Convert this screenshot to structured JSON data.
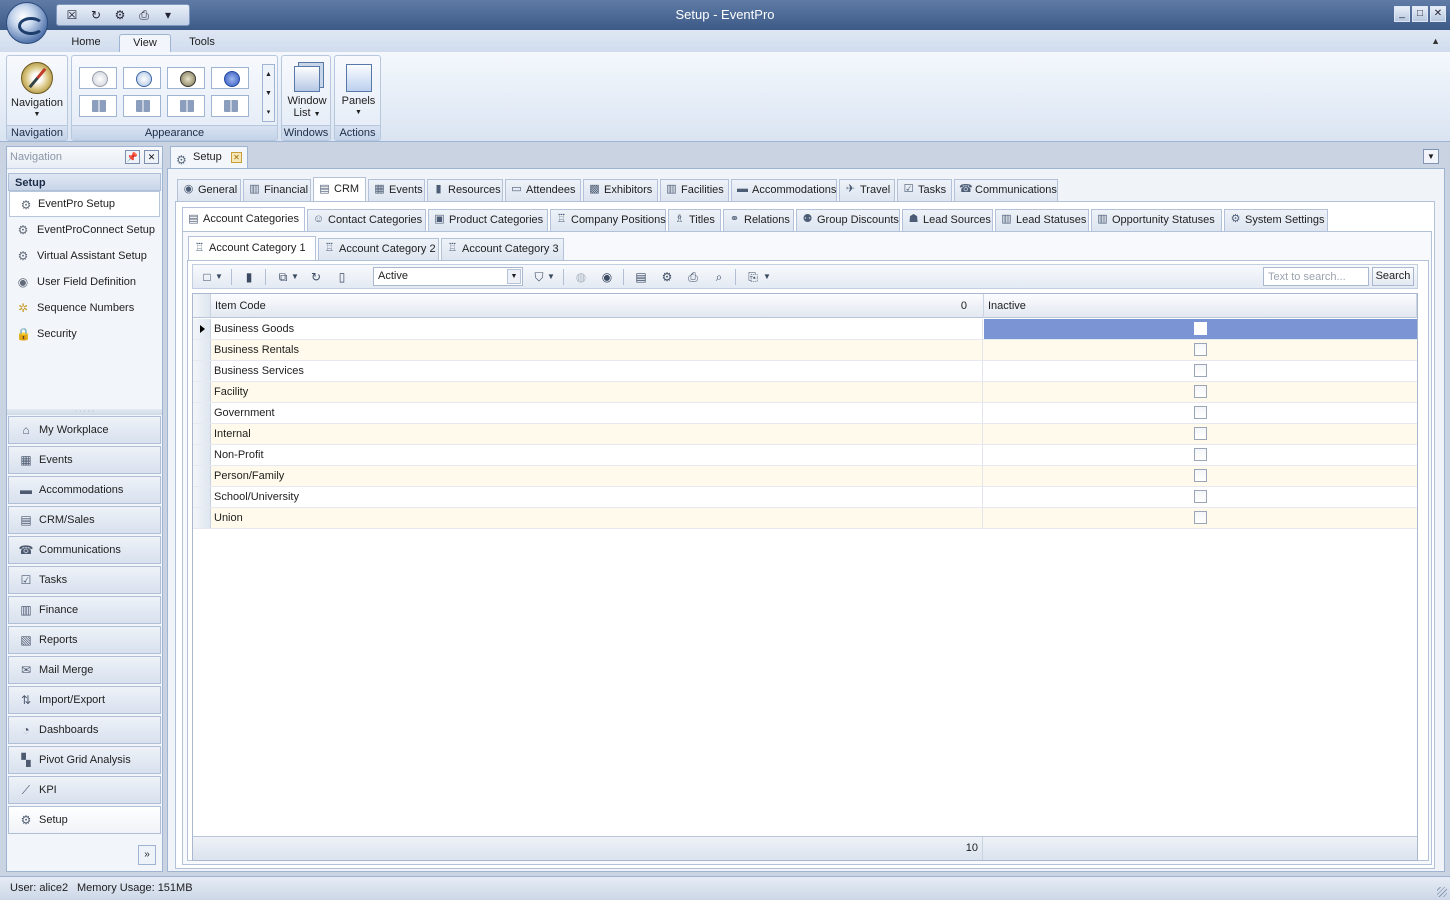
{
  "window": {
    "title": "Setup - EventPro"
  },
  "ribbon": {
    "tabs": [
      "Home",
      "View",
      "Tools"
    ],
    "active_tab": "View",
    "groups": {
      "navigation": {
        "button": "Navigation",
        "label": "Navigation"
      },
      "appearance": {
        "label": "Appearance"
      },
      "windows": {
        "button_line1": "Window",
        "button_line2": "List",
        "label": "Windows"
      },
      "actions": {
        "button": "Panels",
        "label": "Actions"
      }
    }
  },
  "nav": {
    "header": "Navigation",
    "group_title": "Setup",
    "setup_items": [
      {
        "label": "EventPro Setup",
        "icon": "gear-icon"
      },
      {
        "label": "EventProConnect Setup",
        "icon": "gear-icon"
      },
      {
        "label": "Virtual Assistant Setup",
        "icon": "gear-icon"
      },
      {
        "label": "User Field Definition",
        "icon": "eye-icon"
      },
      {
        "label": "Sequence Numbers",
        "icon": "sequence-icon"
      },
      {
        "label": "Security",
        "icon": "lock-icon"
      }
    ],
    "modules": [
      {
        "label": "My Workplace",
        "icon": "house-icon"
      },
      {
        "label": "Events",
        "icon": "calendar-icon"
      },
      {
        "label": "Accommodations",
        "icon": "bed-icon"
      },
      {
        "label": "CRM/Sales",
        "icon": "crm-icon"
      },
      {
        "label": "Communications",
        "icon": "phone-icon"
      },
      {
        "label": "Tasks",
        "icon": "clipboard-icon"
      },
      {
        "label": "Finance",
        "icon": "finance-icon"
      },
      {
        "label": "Reports",
        "icon": "report-icon"
      },
      {
        "label": "Mail Merge",
        "icon": "mail-icon"
      },
      {
        "label": "Import/Export",
        "icon": "import-export-icon"
      },
      {
        "label": "Dashboards",
        "icon": "dashboard-icon"
      },
      {
        "label": "Pivot Grid Analysis",
        "icon": "pivot-icon"
      },
      {
        "label": "KPI",
        "icon": "kpi-icon"
      },
      {
        "label": "Setup",
        "icon": "gear-icon"
      }
    ]
  },
  "document": {
    "tab_label": "Setup",
    "main_tabs": [
      "General",
      "Financial",
      "CRM",
      "Events",
      "Resources",
      "Attendees",
      "Exhibitors",
      "Facilities",
      "Accommodations",
      "Travel",
      "Tasks",
      "Communications"
    ],
    "active_main_tab": "CRM",
    "crm_tabs": [
      "Account Categories",
      "Contact Categories",
      "Product Categories",
      "Company Positions",
      "Titles",
      "Relations",
      "Group Discounts",
      "Lead Sources",
      "Lead Statuses",
      "Opportunity Statuses",
      "System Settings"
    ],
    "active_crm_tab": "Account Categories",
    "category_tabs": [
      "Account Category 1",
      "Account Category 2",
      "Account Category 3"
    ],
    "active_category_tab": "Account Category 1"
  },
  "toolbar": {
    "status_filter": "Active",
    "search_placeholder": "Text to search...",
    "search_button": "Search"
  },
  "grid": {
    "columns": [
      "Item Code",
      "Inactive"
    ],
    "header_count": "0",
    "rows": [
      {
        "code": "Business Goods",
        "inactive": false
      },
      {
        "code": "Business Rentals",
        "inactive": false
      },
      {
        "code": "Business Services",
        "inactive": false
      },
      {
        "code": "Facility",
        "inactive": false
      },
      {
        "code": "Government",
        "inactive": false
      },
      {
        "code": "Internal",
        "inactive": false
      },
      {
        "code": "Non-Profit",
        "inactive": false
      },
      {
        "code": "Person/Family",
        "inactive": false
      },
      {
        "code": "School/University",
        "inactive": false
      },
      {
        "code": "Union",
        "inactive": false
      }
    ],
    "footer_count": "10"
  },
  "status": {
    "user": "User: alice2",
    "memory": "Memory Usage: 151MB"
  }
}
